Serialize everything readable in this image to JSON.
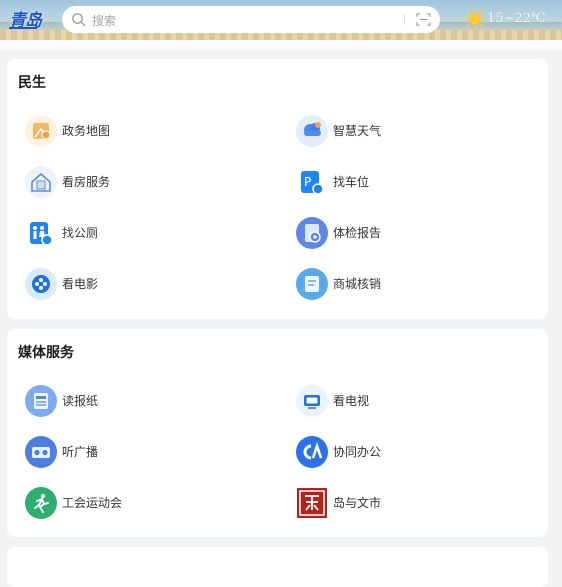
{
  "header": {
    "logo_text": "青岛",
    "search_placeholder": "搜索",
    "weather_temp": "15~22℃"
  },
  "sections": [
    {
      "title": "民生",
      "items": [
        {
          "label": "政务地图",
          "icon": "gov-map-icon"
        },
        {
          "label": "智慧天气",
          "icon": "weather-cloud-icon"
        },
        {
          "label": "看房服务",
          "icon": "house-icon"
        },
        {
          "label": "找车位",
          "icon": "parking-icon"
        },
        {
          "label": "找公厕",
          "icon": "restroom-icon"
        },
        {
          "label": "体检报告",
          "icon": "medical-report-icon"
        },
        {
          "label": "看电影",
          "icon": "film-reel-icon"
        },
        {
          "label": "商城核销",
          "icon": "mall-verify-icon"
        }
      ]
    },
    {
      "title": "媒体服务",
      "items": [
        {
          "label": "读报纸",
          "icon": "newspaper-icon"
        },
        {
          "label": "看电视",
          "icon": "tv-icon"
        },
        {
          "label": "听广播",
          "icon": "radio-icon"
        },
        {
          "label": "协同办公",
          "icon": "office-icon"
        },
        {
          "label": "工会运动会",
          "icon": "runner-icon"
        },
        {
          "label": "岛与文市",
          "icon": "culture-seal-icon"
        }
      ]
    }
  ]
}
